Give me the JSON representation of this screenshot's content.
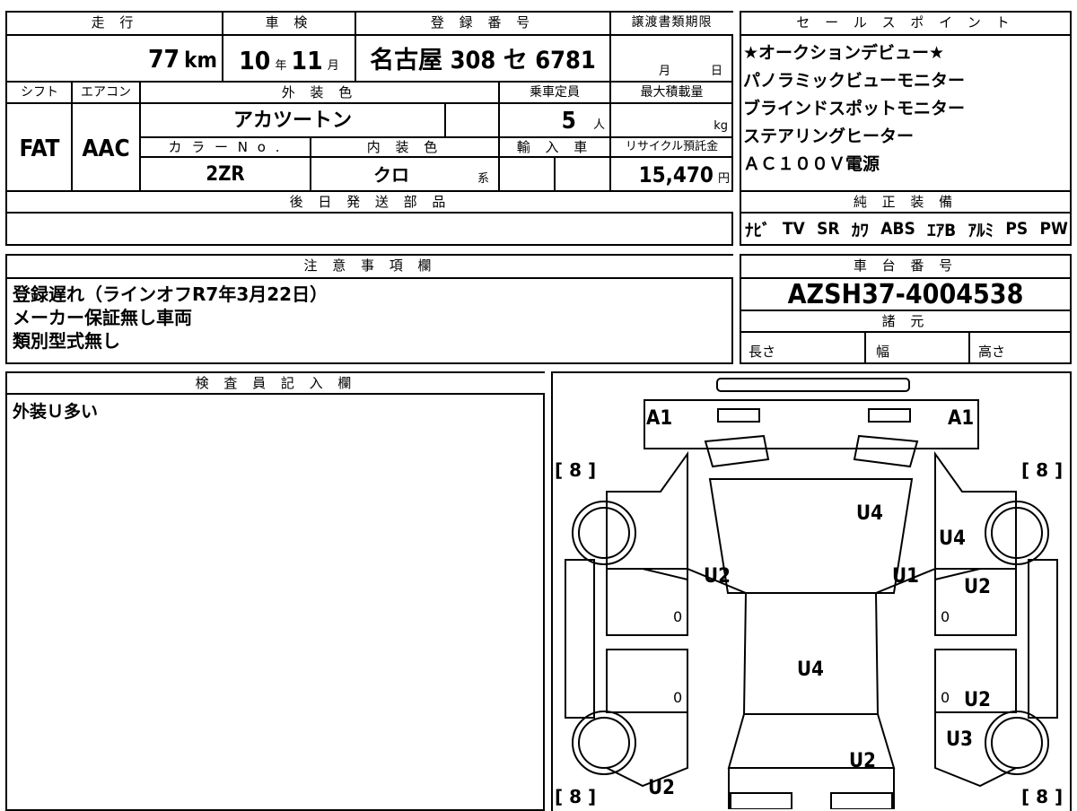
{
  "vehicle": {
    "mileage_label": "走 行",
    "mileage_value": "77",
    "mileage_unit": "km",
    "inspection_label": "車 検",
    "inspection_year": "10",
    "inspection_year_unit": "年",
    "inspection_month": "11",
    "inspection_month_unit": "月",
    "registration_label": "登 録 番 号",
    "registration_value": "名古屋 308 セ 6781",
    "deadline_label": "譲渡書類期限",
    "deadline_month_unit": "月",
    "deadline_day_unit": "日",
    "shift_label": "シフト",
    "shift_value": "FAT",
    "ac_label": "エアコン",
    "ac_value": "AAC",
    "exterior_color_label": "外 装 色",
    "exterior_color_value": "アカツートン",
    "capacity_label": "乗車定員",
    "capacity_value": "5",
    "capacity_unit": "人",
    "max_load_label": "最大積載量",
    "max_load_unit": "kg",
    "color_no_label": "カ ラ ー N o .",
    "color_no_value": "2ZR",
    "interior_color_label": "内 装 色",
    "interior_color_value": "クロ",
    "interior_color_unit": "系",
    "import_label": "輸 入 車",
    "recycle_label": "リサイクル預託金",
    "recycle_value": "15,470",
    "recycle_unit": "円",
    "later_parts_label": "後 日 発 送 部 品"
  },
  "sales_points": {
    "label": "セ ー ル ス ポ イ ン ト",
    "items": [
      "★オークションデビュー★",
      "パノラミックビューモニター",
      "ブラインドスポットモニター",
      "ステアリングヒーター",
      "ＡＣ１００Ｖ電源"
    ]
  },
  "equipment": {
    "label": "純 正 装 備",
    "items": [
      "ﾅﾋﾞ",
      "TV",
      "SR",
      "ｶﾜ",
      "ABS",
      "ｴｱB",
      "ｱﾙﾐ",
      "PS",
      "PW"
    ]
  },
  "notes": {
    "label": "注 意 事 項 欄",
    "lines": [
      "登録遅れ（ラインオフR7年3月22日）",
      "メーカー保証無し車両",
      "類別型式無し"
    ]
  },
  "chassis": {
    "label": "車 台 番 号",
    "value": "AZSH37-4004538",
    "spec_label": "諸 元",
    "length_label": "長さ",
    "width_label": "幅",
    "height_label": "高さ"
  },
  "inspector": {
    "label": "検 査 員 記 入 欄",
    "comment": "外装Ｕ多い"
  },
  "diagram": {
    "marks": {
      "a1_left": "A1",
      "a1_right": "A1",
      "tire_fl": "[ 8 ]",
      "tire_fr": "[ 8 ]",
      "tire_rl": "[ 8 ]",
      "tire_rr": "[ 8 ]",
      "hood": "U4",
      "front_right_fender": "U4",
      "pillar_left": "U2",
      "pillar_right": "U1",
      "front_right_door": "U2",
      "roof": "U4",
      "rear_right_door": "U2",
      "rear_right_fender": "U3",
      "trunk": "U2",
      "rear_left_bumper": "U2",
      "door_fl_zero": "0",
      "door_rl_zero": "0",
      "door_fr_zero": "0",
      "door_rr_zero": "0"
    }
  }
}
